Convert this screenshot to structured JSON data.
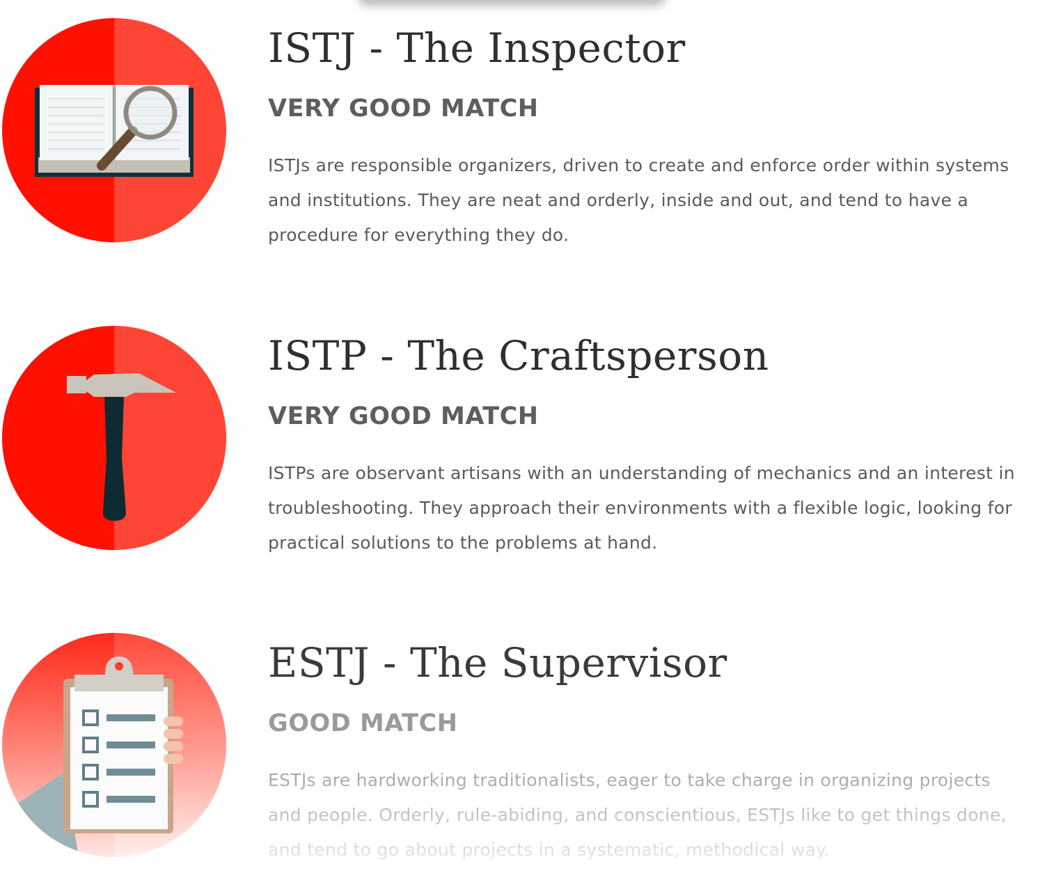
{
  "colors": {
    "circle_dark": "#ff1000",
    "circle_light": "#ff4636",
    "title": "#2f2f2f",
    "match": "#5e5e5e",
    "text": "#5a5a5a"
  },
  "personalities": [
    {
      "title": "ISTJ - The Inspector",
      "match": "VERY GOOD MATCH",
      "description": "ISTJs are responsible organizers, driven to create and enforce order within systems and institutions. They are neat and orderly, inside and out, and tend to have a procedure for everything they do.",
      "icon": "book-magnifier-icon"
    },
    {
      "title": "ISTP - The Craftsperson",
      "match": "VERY GOOD MATCH",
      "description": "ISTPs are observant artisans with an understanding of mechanics and an interest in troubleshooting. They approach their environments with a flexible logic, looking for practical solutions to the problems at hand.",
      "icon": "hammer-icon"
    },
    {
      "title": "ESTJ - The Supervisor",
      "match": "GOOD MATCH",
      "description": "ESTJs are hardworking traditionalists, eager to take charge in organizing projects and people. Orderly, rule-abiding, and conscientious, ESTJs like to get things done, and tend to go about projects in a systematic, methodical way.",
      "icon": "clipboard-checklist-icon"
    }
  ]
}
